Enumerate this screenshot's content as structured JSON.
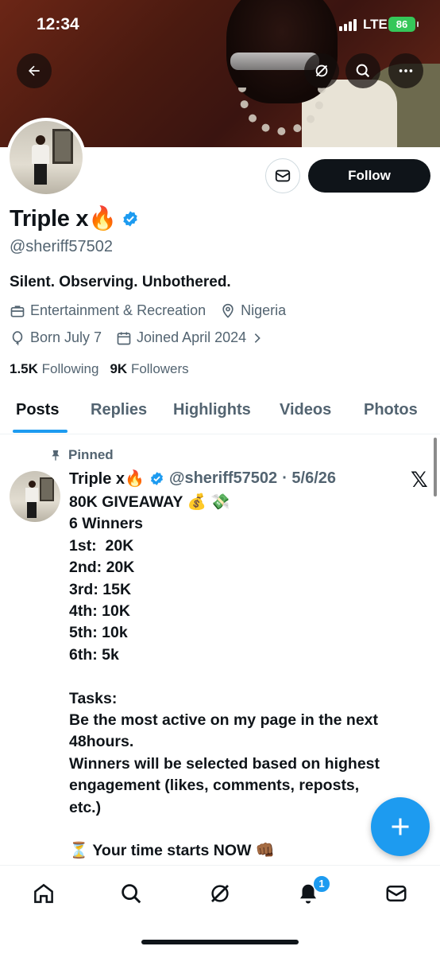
{
  "status_bar": {
    "time": "12:34",
    "network": "LTE",
    "battery": "86"
  },
  "profile": {
    "name": "Triple x🔥",
    "handle": "@sheriff57502",
    "bio": "Silent. Observing. Unbothered.",
    "category": "Entertainment & Recreation",
    "location": "Nigeria",
    "born": "Born July 7",
    "joined": "Joined April 2024",
    "following_count": "1.5K",
    "following_label": "Following",
    "followers_count": "9K",
    "followers_label": "Followers",
    "follow_button": "Follow"
  },
  "tabs": [
    "Posts",
    "Replies",
    "Highlights",
    "Videos",
    "Photos"
  ],
  "pinned_label": "Pinned",
  "post": {
    "author": "Triple x🔥",
    "handle": "@sheriff57502",
    "date": "· 5/6/26",
    "lines": [
      "80K GIVEAWAY 💰 💸",
      "6 Winners",
      "1st:  20K",
      "2nd: 20K",
      "3rd: 15K",
      "4th: 10K",
      "5th: 10k",
      "6th: 5k",
      "",
      "Tasks:",
      "Be the most active on my page in the next",
      "48hours.",
      "Winners will be selected based on highest",
      "engagement (likes, comments, reposts,",
      "etc.)",
      "",
      "⏳ Your time starts NOW 👊🏾"
    ]
  },
  "notifications_badge": "1",
  "colors": {
    "accent": "#1d9bf0",
    "text": "#0f1419",
    "secondary": "#536471"
  }
}
